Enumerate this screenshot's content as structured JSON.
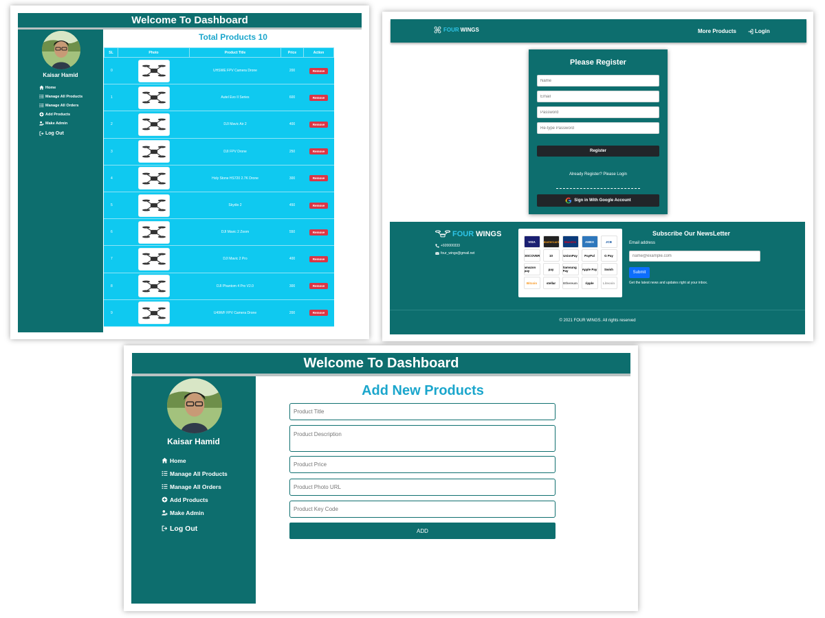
{
  "dashboard_list": {
    "header_title": "Welcome To Dashboard",
    "profile_name": "Kaisar Hamid",
    "nav": [
      {
        "label": "Home",
        "icon": "home-icon"
      },
      {
        "label": "Manage All Products",
        "icon": "list-icon"
      },
      {
        "label": "Manage All Orders",
        "icon": "list-icon"
      },
      {
        "label": "Add Products",
        "icon": "plus-circle-icon"
      },
      {
        "label": "Make Admin",
        "icon": "user-cog-icon"
      },
      {
        "label": "Log Out",
        "icon": "logout-icon"
      }
    ],
    "title": "Total Products 10",
    "columns": [
      "SL",
      "Photo",
      "Product Title",
      "Price",
      "Action"
    ],
    "remove_label": "Remove",
    "rows": [
      {
        "sl": "0",
        "title": "UHSWE FPV Camera Drone",
        "price": "200"
      },
      {
        "sl": "1",
        "title": "Autel Evo II Series",
        "price": "600"
      },
      {
        "sl": "2",
        "title": "DJI Mavic Air 2",
        "price": "400"
      },
      {
        "sl": "3",
        "title": "DJI FPV Drone",
        "price": "250"
      },
      {
        "sl": "4",
        "title": "Holy Stone HS720 2.7K Drone",
        "price": "300"
      },
      {
        "sl": "5",
        "title": "Skydio 2",
        "price": "450"
      },
      {
        "sl": "6",
        "title": "DJI Mavic 2 Zoom",
        "price": "550"
      },
      {
        "sl": "7",
        "title": "DJI Mavic 2 Pro",
        "price": "400"
      },
      {
        "sl": "8",
        "title": "DJI Phantom 4 Pro V2.0",
        "price": "300"
      },
      {
        "sl": "9",
        "title": "U49WF FPV Camera Drone",
        "price": "200"
      }
    ]
  },
  "register_page": {
    "brand_four": "FOUR",
    "brand_wings": "WINGS",
    "nav_more_products": "More Products",
    "nav_login": "Login",
    "card_title": "Please Register",
    "placeholders": {
      "name": "Name",
      "email": "Email",
      "password": "Password",
      "retype": "Re-type Password"
    },
    "register_button": "Register",
    "already_text": "Already Register? Please Login",
    "google_button": "Sign in With Google Account",
    "footer": {
      "phone": "+920000333",
      "email": "four_wings@gmail.net",
      "payments": [
        "VISA",
        "Mastercard",
        "Maestro",
        "AMEX",
        "JCB",
        "DISCOVER",
        "10",
        "UnionPay",
        "PayPal",
        "G Pay",
        "amazon pay",
        "pay",
        "Samsung Pay",
        "Apple Pay",
        "Swish",
        "Bitcoin",
        "stellar",
        "Ethereum",
        "ripple",
        "Litecoin"
      ],
      "newsletter_title": "Subscribe Our NewsLetter",
      "email_label": "Email address",
      "email_placeholder": "name@example.com",
      "submit_label": "Submit",
      "note": "Get the latest news and updates right at your inbox.",
      "copyright": "© 2021 FOUR WINGS. All rights reserved"
    }
  },
  "dashboard_add": {
    "header_title": "Welcome To Dashboard",
    "profile_name": "Kaisar Hamid",
    "nav": [
      {
        "label": "Home",
        "icon": "home-icon"
      },
      {
        "label": "Manage All Products",
        "icon": "list-icon"
      },
      {
        "label": "Manage All Orders",
        "icon": "list-icon"
      },
      {
        "label": "Add Products",
        "icon": "plus-circle-icon"
      },
      {
        "label": "Make Admin",
        "icon": "user-cog-icon"
      },
      {
        "label": "Log Out",
        "icon": "logout-icon"
      }
    ],
    "title": "Add New Products",
    "placeholders": {
      "title": "Product Title",
      "description": "Product Description",
      "price": "Product Price",
      "photo": "Product Photo URL",
      "key": "Product Key Code"
    },
    "add_button": "ADD"
  },
  "colors": {
    "primary_teal": "#0d6e6e",
    "accent_cyan": "#1ba6cc",
    "table_cyan": "#0fc9f0",
    "remove_red": "#dc3545",
    "submit_blue": "#0d6efd",
    "dark_button": "#212529"
  }
}
